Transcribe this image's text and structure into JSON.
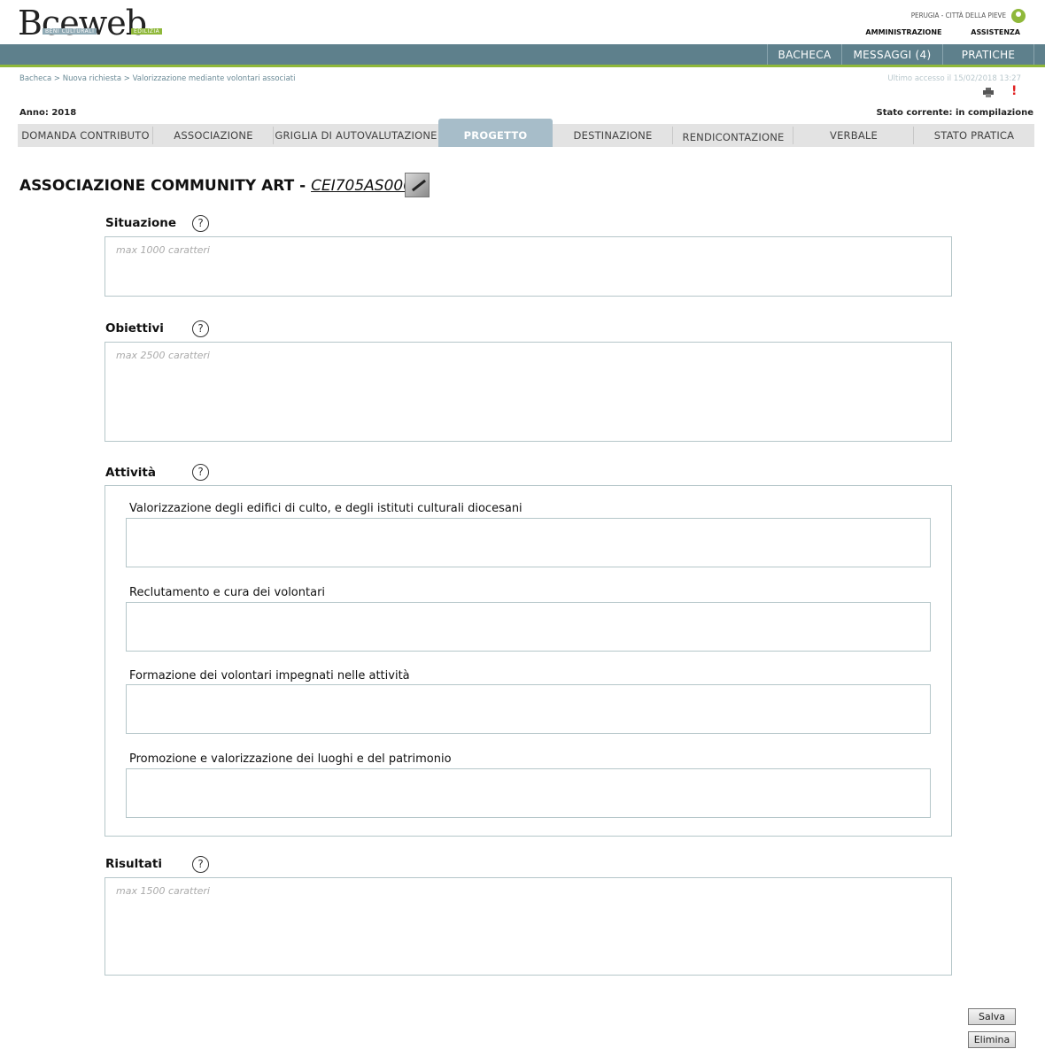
{
  "brand": {
    "logo_text": "Bceweb",
    "logo_sub_left": "BENI CULTURALI",
    "logo_sub_right": "EDILIZIA"
  },
  "header": {
    "location": "PERUGIA - CITTÀ DELLA PIEVE",
    "links": [
      "AMMINISTRAZIONE",
      "ASSISTENZA"
    ]
  },
  "nav": {
    "bacheca": "BACHECA",
    "messaggi": "MESSAGGI (4)",
    "pratiche": "PRATICHE"
  },
  "breadcrumb": "Bacheca > Nuova richiesta > Valorizzazione mediante volontari associati",
  "last_access": "Ultimo accesso il 15/02/2018 13:27",
  "alert_symbol": "!",
  "anno": "Anno: 2018",
  "stato": "Stato corrente: in compilazione",
  "tabs": [
    "DOMANDA CONTRIBUTO",
    "ASSOCIAZIONE",
    "GRIGLIA DI AUTOVALUTAZIONE",
    "PROGETTO",
    "DESTINAZIONE",
    "RENDICONTAZIONE",
    "VERBALE",
    "STATO PRATICA"
  ],
  "active_tab": "PROGETTO",
  "title": {
    "name": "ASSOCIAZIONE COMMUNITY ART - ",
    "code": "CEI705AS0001"
  },
  "help_symbol": "?",
  "sections": {
    "situazione": {
      "label": "Situazione",
      "placeholder": "max 1000 caratteri",
      "value": ""
    },
    "obiettivi": {
      "label": "Obiettivi",
      "placeholder": "max 2500 caratteri",
      "value": ""
    },
    "attivita": {
      "label": "Attività",
      "items": [
        "Valorizzazione degli edifici di culto, e degli istituti culturali diocesani",
        "Reclutamento e cura dei volontari",
        "Formazione dei volontari impegnati nelle attività",
        "Promozione e valorizzazione dei luoghi e del patrimonio"
      ]
    },
    "risultati": {
      "label": "Risultati",
      "placeholder": "max 1500 caratteri",
      "value": ""
    }
  },
  "buttons": {
    "salva": "Salva",
    "elimina": "Elimina"
  },
  "colors": {
    "nav_bg": "#5e808c",
    "accent_green": "#8fb83a",
    "active_tab": "#a7bdc9",
    "alert": "#e02020"
  }
}
